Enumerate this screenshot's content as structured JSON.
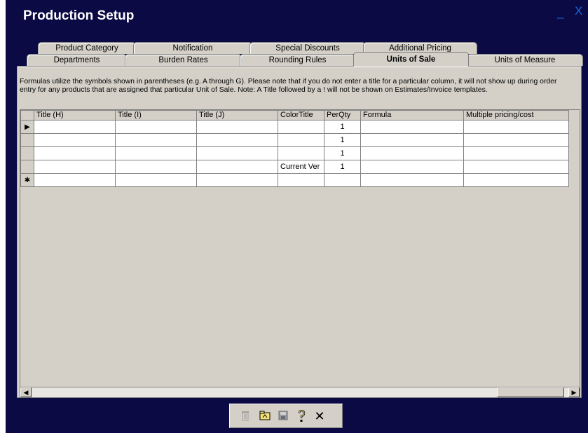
{
  "window": {
    "title": "Production Setup",
    "minimize_label": "_",
    "close_label": "X",
    "background": "#0b0a45"
  },
  "tabs": {
    "back_row": [
      "Product Category",
      "Notification",
      "Special Discounts",
      "Additional Pricing"
    ],
    "front_row": [
      "Departments",
      "Burden Rates",
      "Rounding Rules",
      "Units of Sale",
      "Units of Measure"
    ],
    "active": "Units of Sale"
  },
  "info_text": "Formulas utilize the symbols shown in parentheses (e.g. A through G). Please note that if you do not enter a title for a particular column, it will not show up during order entry for any products that are assigned that particular Unit of Sale. Note: A Title followed by a ! will not be shown on Estimates/Invoice templates.",
  "table": {
    "columns": [
      "Title (H)",
      "Title (I)",
      "Title (J)",
      "ColorTitle",
      "PerQty",
      "Formula",
      "Multiple pricing/cost"
    ],
    "rows": [
      {
        "selector": "▶",
        "cells": [
          "",
          "",
          "",
          "",
          "1",
          "",
          ""
        ]
      },
      {
        "selector": "",
        "cells": [
          "",
          "",
          "",
          "",
          "1",
          "",
          ""
        ]
      },
      {
        "selector": "",
        "cells": [
          "",
          "",
          "",
          "",
          "1",
          "",
          ""
        ]
      },
      {
        "selector": "",
        "cells": [
          "",
          "",
          "",
          "Current Ver",
          "1",
          "",
          ""
        ]
      },
      {
        "selector": "✱",
        "cells": [
          "",
          "",
          "",
          "",
          "",
          "",
          ""
        ]
      }
    ]
  },
  "scrollbar": {
    "left_arrow": "◀",
    "right_arrow": "▶"
  },
  "toolbar": {
    "delete_icon": "trash-icon",
    "open_icon": "folder-icon",
    "save_icon": "disk-icon",
    "help_icon": "help-icon",
    "close_icon": "close-icon"
  }
}
